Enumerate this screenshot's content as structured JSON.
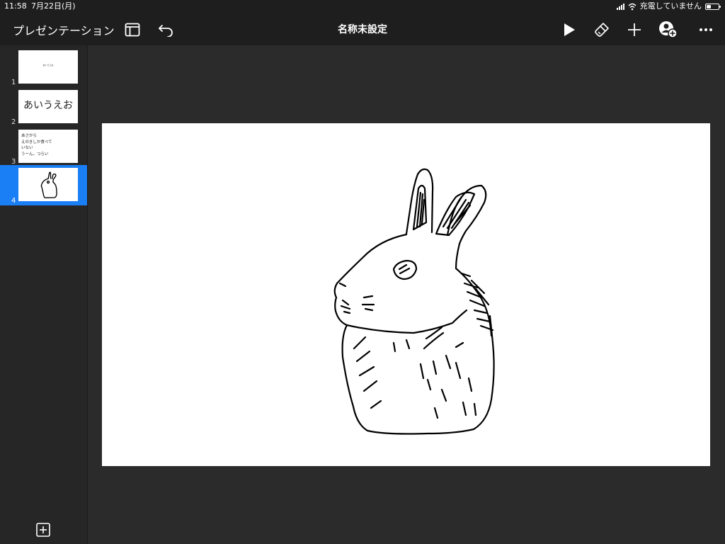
{
  "status_bar": {
    "time": "11:58",
    "date": "7月22日(月)",
    "charging_text": "充電していません",
    "battery_level": 0.35
  },
  "toolbar": {
    "presentations_label": "プレゼンテーション",
    "document_title": "名称未設定",
    "icons": [
      "sidebar-layout-icon",
      "undo-icon",
      "play-icon",
      "format-brush-icon",
      "plus-icon",
      "add-collaborator-icon",
      "more-icon"
    ]
  },
  "slides": [
    {
      "number": "1",
      "text": "あいうえお"
    },
    {
      "number": "2",
      "text": "あいうえお"
    },
    {
      "number": "3",
      "lines": [
        "あさから",
        "えのきしか食べて",
        "いない",
        "うーん。つらい"
      ]
    },
    {
      "number": "4",
      "selected": true
    }
  ],
  "colors": {
    "accent": "#1a7ef5",
    "toolbar_bg": "#1e1e1e",
    "workspace_bg": "#2b2b2b",
    "canvas_bg": "#ffffff"
  }
}
